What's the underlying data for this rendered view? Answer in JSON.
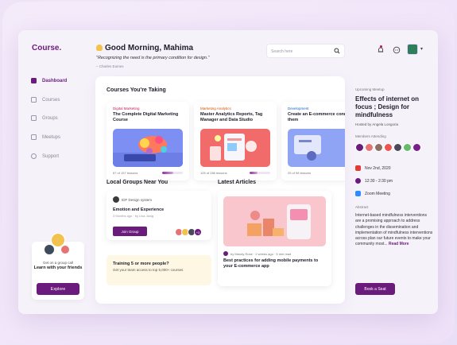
{
  "brand": {
    "logo": "Course."
  },
  "sidebar": {
    "items": [
      {
        "label": "Dashboard",
        "active": true,
        "icon": "dashboard-icon"
      },
      {
        "label": "Courses",
        "active": false,
        "icon": "video-icon"
      },
      {
        "label": "Groups",
        "active": false,
        "icon": "grid-icon"
      },
      {
        "label": "Meetups",
        "active": false,
        "icon": "calendar-icon"
      },
      {
        "label": "Support",
        "active": false,
        "icon": "gear-icon"
      }
    ],
    "group_call": {
      "caption": "Get on a group call",
      "headline": "Learn with your friends",
      "button": "Explore"
    }
  },
  "header": {
    "greeting": "Good Morning, Mahima",
    "quote": "\"Recognizing the need is the primary condition for design.\"",
    "quote_author": "– Charles Eames",
    "search_placeholder": "Search here"
  },
  "courses": {
    "title": "Courses You're Taking",
    "items": [
      {
        "category": "Digital Marketing",
        "category_color": "#c2185b",
        "title": "The Complete Digital Marketing Course",
        "progress_text": "87 of 157 lessons",
        "progress": 0.55
      },
      {
        "category": "Marketing Analytics",
        "category_color": "#d35400",
        "title": "Master Analytics Reports, Tag Manager and Data Studio",
        "progress_text": "105 of 286 lessons",
        "progress": 0.37
      },
      {
        "category": "Development",
        "category_color": "#1565c0",
        "title": "Create an E-commerce connect them",
        "progress_text": "25 of 98 lessons",
        "progress": 0.26
      }
    ]
  },
  "local_groups": {
    "title": "Local Groups Near You",
    "group": {
      "name": "IDF Design system",
      "title": "Emotion and Experience",
      "meta": "3 Months ago · by Lisa Jiang",
      "button": "Join Group",
      "extra_members": "+3"
    },
    "training": {
      "title": "Training 5 or more people?",
      "description": "Get your team access to top 5,000+ courses"
    }
  },
  "articles": {
    "title": "Latest Articles",
    "item": {
      "meta": "by Mandy Rose · 2 weeks ago · 5 min read",
      "title": "Best practices for adding mobile payments to your E-commerce app"
    }
  },
  "meetup": {
    "label": "Upcoming Meetup",
    "title": "Effects of internet on focus ; Design for mindfulness",
    "host": "Hosted by Angela Longoria",
    "members_label": "Members Attending",
    "date": "Nov 2nd, 2020",
    "time": "12:30 - 2:30 pm",
    "platform": "Zoom Meeting",
    "abstract_label": "Abstract",
    "abstract": "Internet-based mindfulness interventions are a promising approach to address challenges in the dissemination and implementation of mindfulness interventions across plan our future events to make your community most...",
    "read_more": "Read More",
    "button": "Book a Seat"
  },
  "colors": {
    "accent": "#6a1b7c",
    "sidebar_active": "#6a1b7c"
  }
}
